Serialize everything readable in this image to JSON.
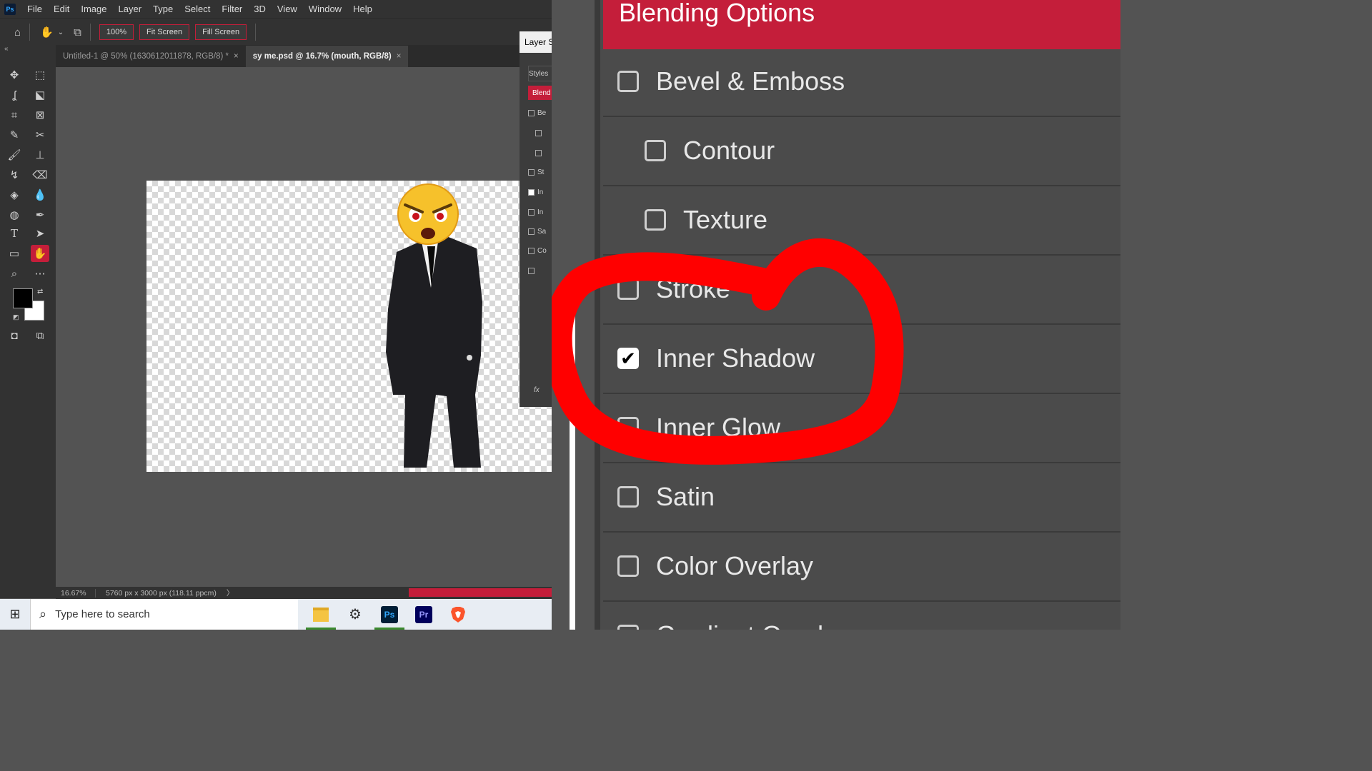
{
  "menubar": {
    "logo": "Ps",
    "items": [
      "File",
      "Edit",
      "Image",
      "Layer",
      "Type",
      "Select",
      "Filter",
      "3D",
      "View",
      "Window",
      "Help"
    ]
  },
  "options": {
    "zoom_value": "100%",
    "fit_screen": "Fit Screen",
    "fill_screen": "Fill Screen"
  },
  "tabs": [
    {
      "label": "Untitled-1 @ 50% (1630612011878, RGB/8) *",
      "close": "×"
    },
    {
      "label": "sy me.psd @ 16.7% (mouth, RGB/8)",
      "close": "×"
    }
  ],
  "status": {
    "zoom": "16.67%",
    "doc_info": "5760 px x 3000 px (118.11 ppcm)",
    "arrow": "〉"
  },
  "layer_style_dialog": {
    "title": "Layer S",
    "rows": [
      {
        "label": "Styles",
        "checkbox": false,
        "checked": false
      },
      {
        "label": "Blend",
        "checkbox": false,
        "checked": false
      },
      {
        "label": "Be",
        "checkbox": true,
        "checked": false
      },
      {
        "label": "",
        "checkbox": true,
        "checked": false
      },
      {
        "label": "",
        "checkbox": true,
        "checked": false
      },
      {
        "label": "St",
        "checkbox": true,
        "checked": false
      },
      {
        "label": "In",
        "checkbox": true,
        "checked": true
      },
      {
        "label": "In",
        "checkbox": true,
        "checked": false
      },
      {
        "label": "Sa",
        "checkbox": true,
        "checked": false
      },
      {
        "label": "Co",
        "checkbox": true,
        "checked": false
      },
      {
        "label": "",
        "checkbox": true,
        "checked": false
      }
    ],
    "fx": "fx"
  },
  "zoomed_panel": {
    "header": "Blending Options",
    "items": [
      {
        "label": "Bevel & Emboss",
        "checked": false
      },
      {
        "label": "Contour",
        "checked": false,
        "indent": true
      },
      {
        "label": "Texture",
        "checked": false,
        "indent": true
      },
      {
        "label": "Stroke",
        "checked": false,
        "bracket": true
      },
      {
        "label": "Inner Shadow",
        "checked": true,
        "bracket": true
      },
      {
        "label": "Inner Glow",
        "checked": false
      },
      {
        "label": "Satin",
        "checked": false
      },
      {
        "label": "Color Overlay",
        "checked": false,
        "bracket": true
      },
      {
        "label": "Gradient Overlay",
        "checked": false
      }
    ],
    "annotation_color": "#ff0000"
  },
  "taskbar": {
    "search_placeholder": "Type here to search",
    "apps": [
      "file-explorer-icon",
      "settings-icon",
      "photoshop-icon",
      "premiere-icon",
      "brave-icon"
    ],
    "ps_label": "Ps",
    "pr_label": "Pr"
  },
  "colors": {
    "accent": "#c41e3a",
    "panel": "#323232",
    "canvas_bg": "#535353"
  }
}
